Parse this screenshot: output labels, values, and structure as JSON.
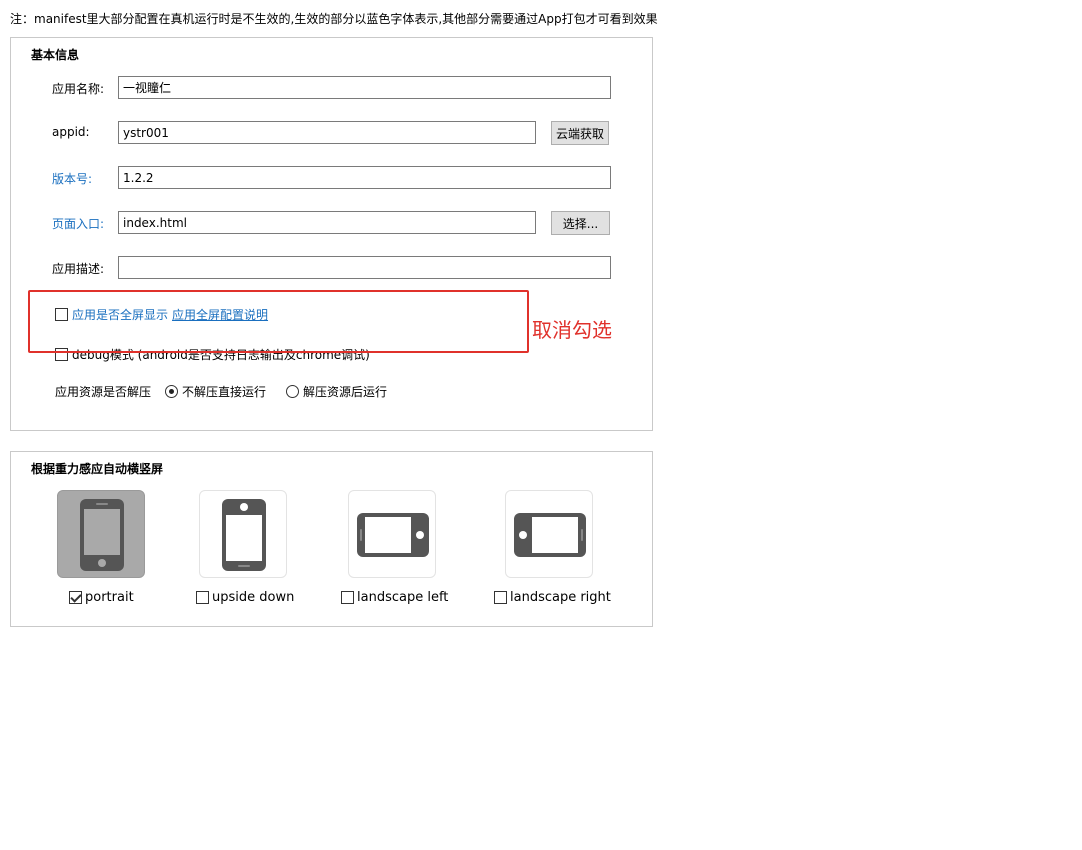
{
  "note": "注：manifest里大部分配置在真机运行时是不生效的,生效的部分以蓝色字体表示,其他部分需要通过App打包才可看到效果",
  "basic": {
    "title": "基本信息",
    "name_label": "应用名称:",
    "name_value": "一视瞳仁",
    "appid_label": "appid:",
    "appid_value": "ystr001",
    "cloud_button": "云端获取",
    "version_label": "版本号:",
    "version_value": "1.2.2",
    "entry_label": "页面入口:",
    "entry_value": "index.html",
    "choose_button": "选择...",
    "desc_label": "应用描述:",
    "desc_value": "",
    "fullscreen_label": "应用是否全屏显示",
    "fullscreen_link": "应用全屏配置说明",
    "debug_label": "debug模式 (android是否支持日志输出及chrome调试)",
    "unzip_label": "应用资源是否解压",
    "unzip_option1": "不解压直接运行",
    "unzip_option2": "解压资源后运行"
  },
  "annotation": {
    "text": "取消勾选",
    "color": "#e0312b"
  },
  "orientation": {
    "title": "根据重力感应自动横竖屏",
    "items": [
      {
        "label": "portrait",
        "checked": true,
        "icon": "phone-portrait-icon"
      },
      {
        "label": "upside down",
        "checked": false,
        "icon": "phone-upside-down-icon"
      },
      {
        "label": "landscape left",
        "checked": false,
        "icon": "phone-landscape-left-icon"
      },
      {
        "label": "landscape right",
        "checked": false,
        "icon": "phone-landscape-right-icon"
      }
    ]
  },
  "colors": {
    "blue_text": "#1a6fbf",
    "icon": "#555555",
    "selected_bg": "#a9a9a9"
  }
}
